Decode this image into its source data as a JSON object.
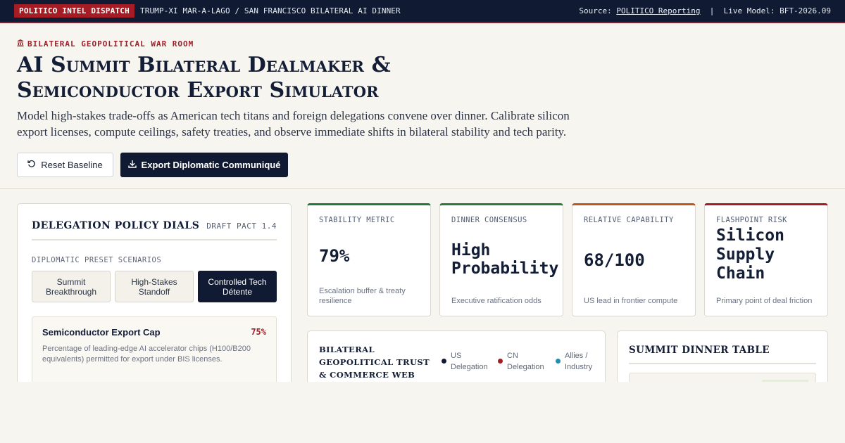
{
  "topbar": {
    "badge": "POLITICO INTEL DISPATCH",
    "headline": "TRUMP-XI MAR-A-LAGO / SAN FRANCISCO BILATERAL AI DINNER",
    "source_prefix": "Source: ",
    "source_link": "POLITICO Reporting",
    "separator": "  |  ",
    "live_model": "Live Model: BFT-2026.09"
  },
  "header": {
    "eyebrow_icon": "landmark-icon",
    "eyebrow": "BILATERAL GEOPOLITICAL WAR ROOM",
    "title_line1": "AI Summit Bilateral Dealmaker &",
    "title_line2": "Semiconductor Export Simulator",
    "subtitle": "Model high-stakes trade-offs as American tech titans and foreign delegations convene over dinner. Calibrate silicon export licenses, compute ceilings, safety treaties, and observe immediate shifts in bilateral stability and tech parity.",
    "reset_label": "Reset Baseline",
    "export_label": "Export Diplomatic Communiqué"
  },
  "policy_panel": {
    "title": "DELEGATION POLICY DIALS",
    "tag": "DRAFT PACT 1.4",
    "presets_label": "DIPLOMATIC PRESET SCENARIOS",
    "presets": [
      {
        "label": "Summit Breakthrough",
        "active": false
      },
      {
        "label": "High-Stakes Standoff",
        "active": false
      },
      {
        "label": "Controlled Tech Détente",
        "active": true
      }
    ],
    "dial": {
      "name": "Semiconductor Export Cap",
      "value": "75%",
      "description": "Percentage of leading-edge AI accelerator chips (H100/B200 equivalents) permitted for export under BIS licenses."
    }
  },
  "metrics": [
    {
      "label": "STABILITY METRIC",
      "value": "79%",
      "description": "Escalation buffer & treaty resilience",
      "color": "#217a3a"
    },
    {
      "label": "DINNER CONSENSUS",
      "value": "High Probability",
      "description": "Executive ratification odds",
      "color": "#2a7a3a"
    },
    {
      "label": "RELATIVE CAPABILITY",
      "value": "68/100",
      "description": "US lead in frontier compute",
      "color": "#c2571a"
    },
    {
      "label": "FLASHPOINT RISK",
      "value": "Silicon Supply Chain",
      "description": "Primary point of deal friction",
      "color": "#a51c24"
    }
  ],
  "trust_web": {
    "title": "BILATERAL GEOPOLITICAL TRUST & COMMERCE WEB",
    "legend": [
      {
        "label": "US Delegation",
        "color": "#101b33"
      },
      {
        "label": "CN Delegation",
        "color": "#a51c24"
      },
      {
        "label": "Allies / Industry",
        "color": "#1b8fb5"
      }
    ]
  },
  "dinner": {
    "title": "SUMMIT DINNER TABLE"
  },
  "colors": {
    "navy": "#101b33",
    "accent_red": "#a51c24",
    "background": "#f7f5f0"
  }
}
